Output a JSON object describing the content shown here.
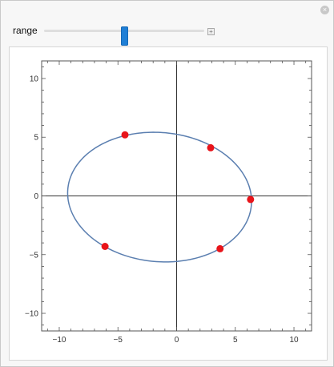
{
  "controls": {
    "range_label": "range",
    "range_value_fraction": 0.5,
    "close_icon": "close-icon",
    "plus_icon": "plus-icon"
  },
  "chart_data": {
    "type": "scatter",
    "xlim": [
      -11.5,
      11.5
    ],
    "ylim": [
      -11.5,
      11.5
    ],
    "x_ticks": [
      -10,
      -5,
      0,
      5,
      10
    ],
    "y_ticks": [
      -10,
      -5,
      0,
      5,
      10
    ],
    "x_tick_labels": [
      "−10",
      "−5",
      "0",
      "5",
      "10"
    ],
    "y_tick_labels": [
      "−10",
      "−5",
      "0",
      "5",
      "10"
    ],
    "grid": false,
    "curve": {
      "kind": "ellipse",
      "center": [
        -1.45,
        -0.1
      ],
      "semi_axes": [
        7.85,
        5.5
      ],
      "rotation_deg": -5,
      "color": "#5b7fb0"
    },
    "points": [
      {
        "x": -4.4,
        "y": 5.2
      },
      {
        "x": 2.9,
        "y": 4.1
      },
      {
        "x": 6.3,
        "y": -0.3
      },
      {
        "x": 3.7,
        "y": -4.5
      },
      {
        "x": -6.1,
        "y": -4.3
      }
    ],
    "point_color": "#e8141a"
  }
}
